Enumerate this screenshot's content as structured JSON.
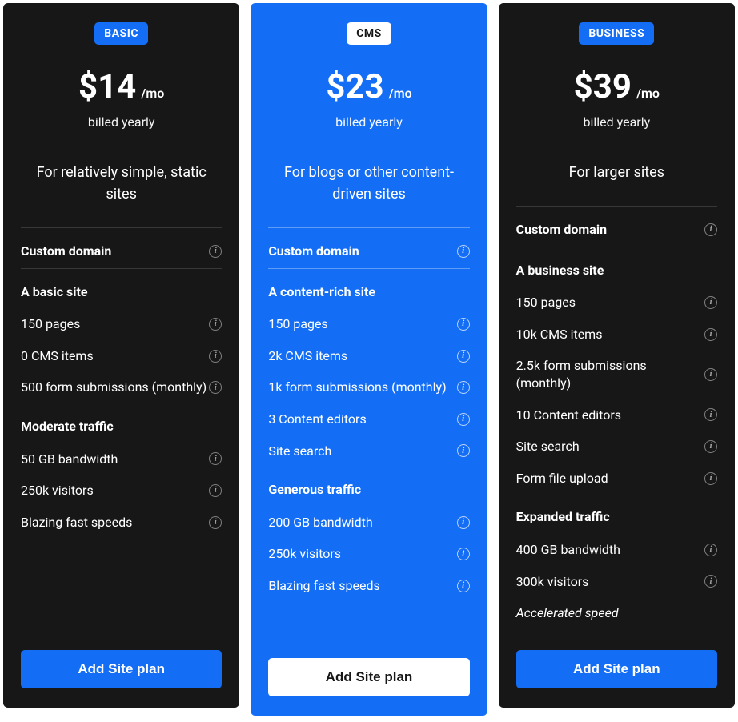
{
  "plans": [
    {
      "name": "BASIC",
      "price": "$14",
      "per": "/mo",
      "billed": "billed yearly",
      "desc": "For relatively simple, static sites",
      "sections": [
        {
          "head": null,
          "items": [
            {
              "t": "Custom domain",
              "i": true
            }
          ]
        },
        {
          "head": "A basic site",
          "items": [
            {
              "t": "150 pages",
              "i": true
            },
            {
              "t": "0 CMS items",
              "i": true
            },
            {
              "t": "500 form submissions (monthly)",
              "i": true
            }
          ]
        },
        {
          "head": "Moderate traffic",
          "items": [
            {
              "t": "50 GB bandwidth",
              "i": true
            },
            {
              "t": "250k visitors",
              "i": true
            },
            {
              "t": "Blazing fast speeds",
              "i": true
            }
          ]
        }
      ],
      "cta": "Add Site plan"
    },
    {
      "name": "CMS",
      "price": "$23",
      "per": "/mo",
      "billed": "billed yearly",
      "desc": "For blogs or other content-driven sites",
      "sections": [
        {
          "head": null,
          "items": [
            {
              "t": "Custom domain",
              "i": true
            }
          ]
        },
        {
          "head": "A content-rich site",
          "items": [
            {
              "t": "150 pages",
              "i": true
            },
            {
              "t": "2k CMS items",
              "i": true
            },
            {
              "t": "1k form submissions (monthly)",
              "i": true
            },
            {
              "t": "3 Content editors",
              "i": true
            },
            {
              "t": "Site search",
              "i": true
            }
          ]
        },
        {
          "head": "Generous traffic",
          "items": [
            {
              "t": "200 GB bandwidth",
              "i": true
            },
            {
              "t": "250k visitors",
              "i": true
            },
            {
              "t": "Blazing fast speeds",
              "i": true
            }
          ]
        }
      ],
      "cta": "Add Site plan"
    },
    {
      "name": "BUSINESS",
      "price": "$39",
      "per": "/mo",
      "billed": "billed yearly",
      "desc": "For larger sites",
      "sections": [
        {
          "head": null,
          "items": [
            {
              "t": "Custom domain",
              "i": true
            }
          ]
        },
        {
          "head": "A business site",
          "items": [
            {
              "t": "150 pages",
              "i": true
            },
            {
              "t": "10k CMS items",
              "i": true
            },
            {
              "t": "2.5k form submissions (monthly)",
              "i": true
            },
            {
              "t": "10 Content editors",
              "i": true
            },
            {
              "t": "Site search",
              "i": true
            },
            {
              "t": "Form file upload",
              "i": true
            }
          ]
        },
        {
          "head": "Expanded traffic",
          "items": [
            {
              "t": "400 GB bandwidth",
              "i": true
            },
            {
              "t": "300k visitors",
              "i": true
            },
            {
              "t": "Accelerated speed",
              "i": false,
              "italic": true
            }
          ]
        }
      ],
      "cta": "Add Site plan"
    }
  ]
}
